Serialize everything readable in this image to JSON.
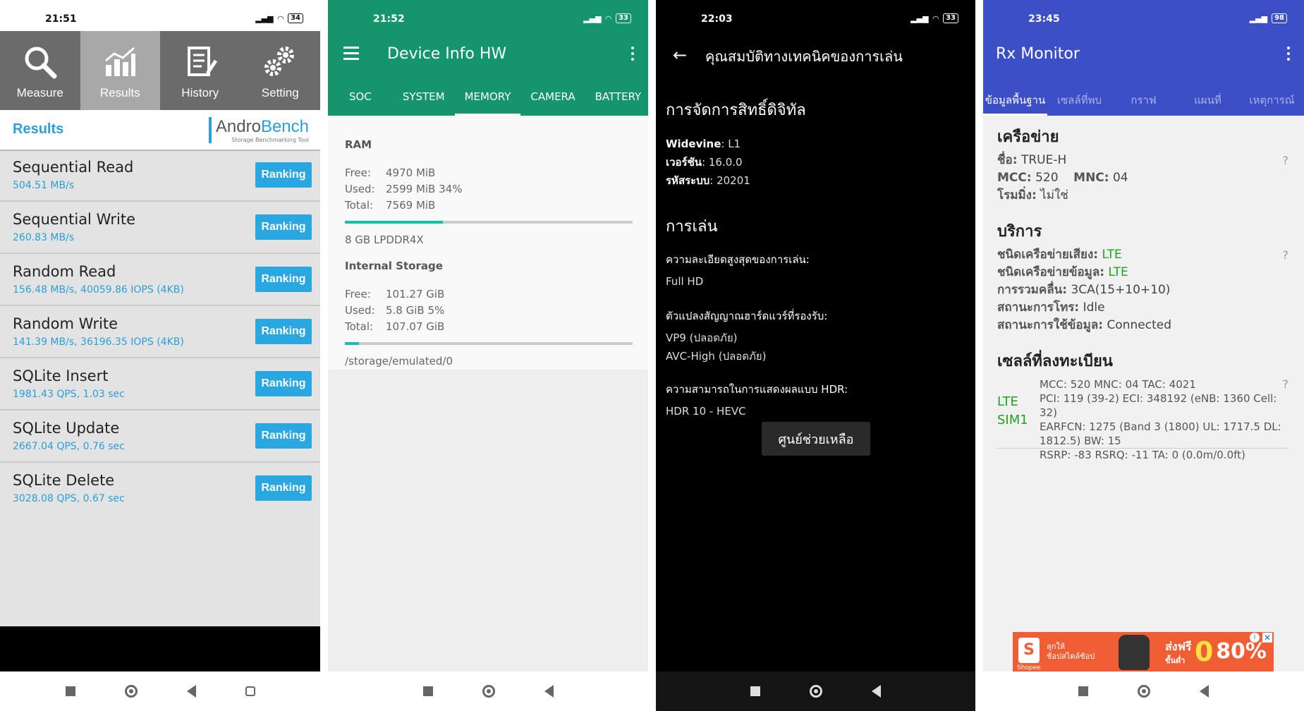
{
  "androbench": {
    "status": {
      "time": "21:51",
      "battery": "34"
    },
    "tabs": [
      {
        "label": "Measure",
        "icon": "search-icon"
      },
      {
        "label": "Results",
        "icon": "chart-icon"
      },
      {
        "label": "History",
        "icon": "history-icon"
      },
      {
        "label": "Setting",
        "icon": "gear-icon"
      }
    ],
    "header_title": "Results",
    "logo": {
      "andro": "Andro",
      "bench": "Bench",
      "sub": "Storage Benchmarking Tool"
    },
    "ranking_label": "Ranking",
    "results": [
      {
        "name": "Sequential Read",
        "value": "504.51 MB/s"
      },
      {
        "name": "Sequential Write",
        "value": "260.83 MB/s"
      },
      {
        "name": "Random Read",
        "value": "156.48 MB/s, 40059.86 IOPS (4KB)"
      },
      {
        "name": "Random Write",
        "value": "141.39 MB/s, 36196.35 IOPS (4KB)"
      },
      {
        "name": "SQLite Insert",
        "value": "1981.43 QPS, 1.03 sec"
      },
      {
        "name": "SQLite Update",
        "value": "2667.04 QPS, 0.76 sec"
      },
      {
        "name": "SQLite Delete",
        "value": "3028.08 QPS, 0.67 sec"
      }
    ]
  },
  "deviceinfo": {
    "status": {
      "time": "21:52",
      "battery": "33"
    },
    "title": "Device Info HW",
    "tabs": [
      "SOC",
      "SYSTEM",
      "MEMORY",
      "CAMERA",
      "BATTERY"
    ],
    "ram": {
      "heading": "RAM",
      "free_label": "Free:",
      "free": "4970 MiB",
      "used_label": "Used:",
      "used": "2599 MiB 34%",
      "total_label": "Total:",
      "total": "7569 MiB",
      "used_fraction": 0.34,
      "type": "8 GB LPDDR4X"
    },
    "storage": {
      "heading": "Internal Storage",
      "free_label": "Free:",
      "free": "101.27 GiB",
      "used_label": "Used:",
      "used": "5.8 GiB 5%",
      "total_label": "Total:",
      "total": "107.07 GiB",
      "used_fraction": 0.05,
      "path": "/storage/emulated/0"
    }
  },
  "widevine": {
    "status": {
      "time": "22:03",
      "battery": "33"
    },
    "title": "คุณสมบัติทางเทคนิคของการเล่น",
    "drm_heading": "การจัดการสิทธิ์ดิจิทัล",
    "drm": [
      {
        "k": "Widevine",
        "v": ": L1"
      },
      {
        "k": "เวอร์ชัน",
        "v": ": 16.0.0"
      },
      {
        "k": "รหัสระบบ",
        "v": ": 20201"
      }
    ],
    "play_heading": "การเล่น",
    "max_res_label": "ความละเอียดสูงสุดของการเล่น:",
    "max_res": "Full HD",
    "decoder_label": "ตัวแปลงสัญญาณฮาร์ดแวร์ที่รองรับ:",
    "decoders": [
      "VP9 (ปลอดภัย)",
      "AVC-High (ปลอดภัย)"
    ],
    "hdr_label": "ความสามารถในการแสดงผลแบบ HDR:",
    "hdr": "HDR 10 - HEVC",
    "help_button": "ศูนย์ช่วยเหลือ"
  },
  "rxmonitor": {
    "status": {
      "time": "23:45",
      "battery": "98"
    },
    "title": "Rx Monitor",
    "tabs": [
      "ข้อมูลพื้นฐาน",
      "เซลล์ที่พบ",
      "กราฟ",
      "แผนที่",
      "เหตุการณ์"
    ],
    "network_heading": "เครือข่าย",
    "name_label": "ชื่อ:",
    "name": "TRUE-H",
    "mcc_label": "MCC:",
    "mcc": "520",
    "mnc_label": "MNC:",
    "mnc": "04",
    "roaming_label": "โรมมิ่ง:",
    "roaming": "ไม่ใช่",
    "service_heading": "บริการ",
    "voice_label": "ชนิดเครือข่ายเสียง:",
    "voice": "LTE",
    "data_label": "ชนิดเครือข่ายข้อมูล:",
    "data": "LTE",
    "ca_label": "การรวมคลื่น:",
    "ca": "3CA(15+10+10)",
    "call_label": "สถานะการโทร:",
    "call": "Idle",
    "datastate_label": "สถานะการใช้ข้อมูล:",
    "datastate": "Connected",
    "cell_heading": "เซลล์ที่ลงทะเบียน",
    "cell_tech": "LTE",
    "cell_sim": "SIM1",
    "cell_lines": [
      "MCC: 520  MNC: 04  TAC: 4021",
      "PCI: 119 (39-2)  ECI: 348192 (eNB: 1360 Cell: 32)",
      "EARFCN: 1275 (Band 3 (1800) UL: 1717.5 DL: 1812.5)  BW: 15",
      "RSRP: -83  RSRQ: -11  TA: 0 (0.0m/0.0ft)"
    ],
    "help_mark": "?",
    "ad": {
      "brand": "Shopee",
      "line1": "ลุกให้",
      "line2": "ช้อปสไตล์ช้อป",
      "free1": "ส่งฟรี",
      "free2": "ขั้นต่ำ",
      "zero": "0",
      "discount": "80%"
    }
  }
}
